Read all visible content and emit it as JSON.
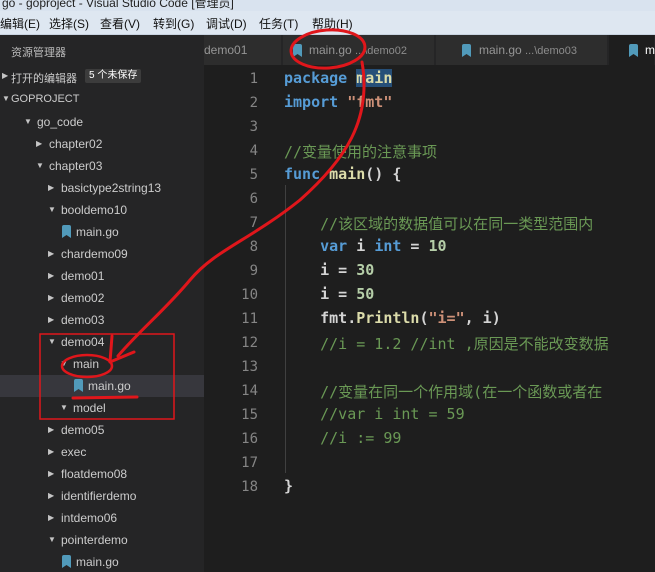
{
  "window": {
    "title": "go - goproject - Visual Studio Code [管理员]"
  },
  "menu": [
    "编辑(E)",
    "选择(S)",
    "查看(V)",
    "转到(G)",
    "调试(D)",
    "任务(T)",
    "帮助(H)"
  ],
  "sidebar": {
    "title": "资源管理器",
    "open_editors": {
      "label": "打开的编辑器",
      "badge": "5 个未保存"
    },
    "project": "GOPROJECT",
    "tree": [
      {
        "label": "go_code",
        "kind": "folder",
        "open": true
      },
      {
        "label": "chapter02",
        "kind": "folder",
        "open": false
      },
      {
        "label": "chapter03",
        "kind": "folder",
        "open": true
      },
      {
        "label": "basictype2string13",
        "kind": "folder",
        "open": false
      },
      {
        "label": "booldemo10",
        "kind": "folder",
        "open": true
      },
      {
        "label": "main.go",
        "kind": "file"
      },
      {
        "label": "chardemo09",
        "kind": "folder",
        "open": false
      },
      {
        "label": "demo01",
        "kind": "folder",
        "open": false
      },
      {
        "label": "demo02",
        "kind": "folder",
        "open": false
      },
      {
        "label": "demo03",
        "kind": "folder",
        "open": false
      },
      {
        "label": "demo04",
        "kind": "folder",
        "open": true
      },
      {
        "label": "main",
        "kind": "folder",
        "open": true
      },
      {
        "label": "main.go",
        "kind": "file",
        "selected": true
      },
      {
        "label": "model",
        "kind": "folder",
        "open": true
      },
      {
        "label": "demo05",
        "kind": "folder",
        "open": false
      },
      {
        "label": "exec",
        "kind": "folder",
        "open": false
      },
      {
        "label": "floatdemo08",
        "kind": "folder",
        "open": false
      },
      {
        "label": "identifierdemo",
        "kind": "folder",
        "open": false
      },
      {
        "label": "intdemo06",
        "kind": "folder",
        "open": false
      },
      {
        "label": "pointerdemo",
        "kind": "folder",
        "open": true
      },
      {
        "label": "main.go",
        "kind": "file"
      }
    ]
  },
  "tabs": [
    {
      "label": "demo01",
      "path": ""
    },
    {
      "label": "main.go",
      "path": "...\\demo02"
    },
    {
      "label": "main.go",
      "path": "...\\demo03"
    },
    {
      "label": "m",
      "path": ""
    }
  ],
  "editor": {
    "line_numbers": [
      "1",
      "2",
      "3",
      "4",
      "5",
      "6",
      "7",
      "8",
      "9",
      "10",
      "11",
      "12",
      "13",
      "14",
      "15",
      "16",
      "17",
      "18"
    ],
    "lines": [
      "package main",
      "import \"fmt\"",
      "",
      "//变量使用的注意事项",
      "func main() {",
      "",
      "    //该区域的数据值可以在同一类型范围内",
      "    var i int = 10",
      "    i = 30",
      "    i = 50",
      "    fmt.Println(\"i=\", i)",
      "    //i = 1.2 //int ,原因是不能改变数据",
      "",
      "    //变量在同一个作用域(在一个函数或者在",
      "    //var i int = 59",
      "    //i := 99",
      "",
      "}"
    ]
  },
  "colors": {
    "annotation": "#e0161b",
    "go_icon": "#519aba",
    "accent": "#569cd6"
  },
  "icons": {
    "go_file": "go-file-icon",
    "collapse": "chevron-down-icon",
    "expand": "chevron-right-icon"
  }
}
